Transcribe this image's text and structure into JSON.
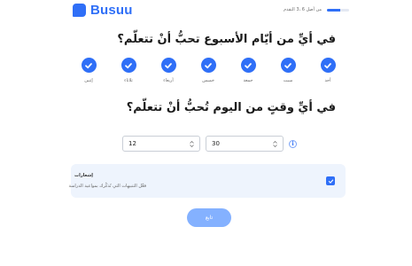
{
  "app": {
    "logo_text": "Busuu",
    "brand_color": "#2f6ff7"
  },
  "progress": {
    "text": "من أصل 6 ،3 التقدم",
    "current": 3,
    "total": 6,
    "fraction": 0.6
  },
  "question_days": "في أيِّ من أيّام الأسبوع تحبُّ أنْ تتعلّم؟",
  "days": [
    {
      "label": "أحد",
      "checked": true
    },
    {
      "label": "سبت",
      "checked": true
    },
    {
      "label": "جمعة",
      "checked": true
    },
    {
      "label": "خميس",
      "checked": true
    },
    {
      "label": "أربعاء",
      "checked": true
    },
    {
      "label": "ثلاثاء",
      "checked": true
    },
    {
      "label": "إثنين",
      "checked": true
    }
  ],
  "question_time": "في أيِّ وقتٍ من اليوم تُحبُّ أنْ تتعلّم؟",
  "time": {
    "hour": "12",
    "minute": "30"
  },
  "info_icon": "info-icon",
  "notifications": {
    "title": "إشعارات",
    "description": "فعِّل التنبيهات التي تُذكّرك بمواعيد الدراسة",
    "checked": true
  },
  "next_button": "تابع"
}
